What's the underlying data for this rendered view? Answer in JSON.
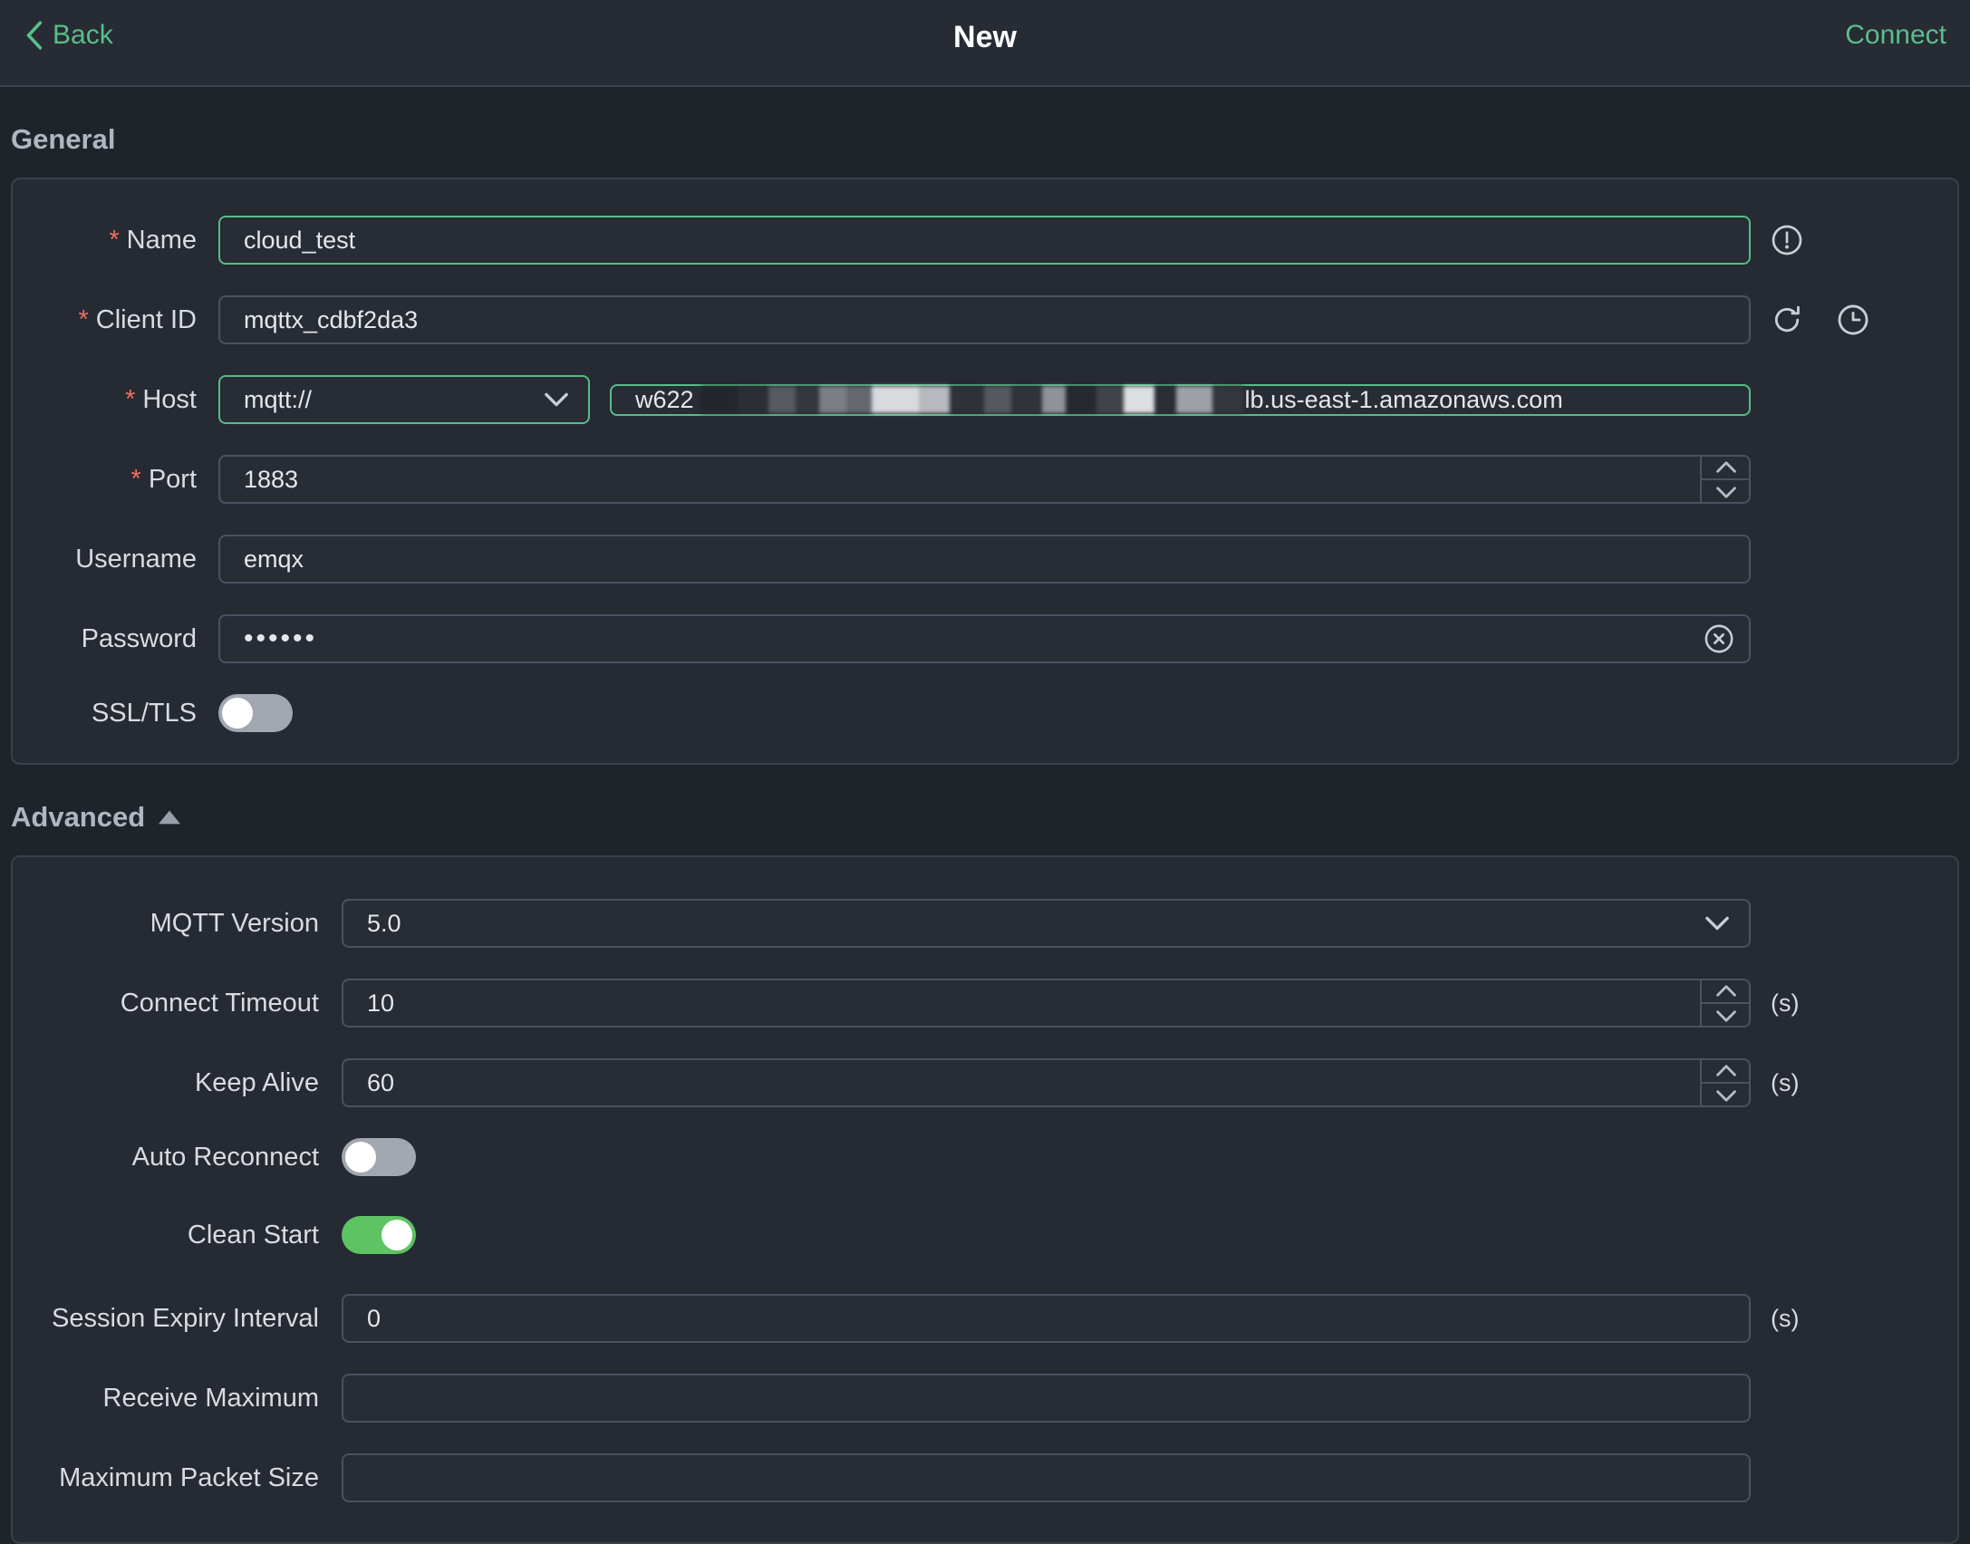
{
  "topbar": {
    "back_label": "Back",
    "title": "New",
    "connect_label": "Connect"
  },
  "ui": {
    "required_marker": "*"
  },
  "sections": {
    "general_title": "General",
    "advanced_title": "Advanced"
  },
  "general": {
    "name": {
      "label": "Name",
      "value": "cloud_test"
    },
    "client_id": {
      "label": "Client ID",
      "value": "mqttx_cdbf2da3"
    },
    "host": {
      "label": "Host",
      "protocol": "mqtt://",
      "value_prefix": "w622",
      "value_suffix": "lb.us-east-1.amazonaws.com"
    },
    "port": {
      "label": "Port",
      "value": "1883"
    },
    "username": {
      "label": "Username",
      "value": "emqx"
    },
    "password": {
      "label": "Password",
      "value": "••••••"
    },
    "ssl": {
      "label": "SSL/TLS",
      "state": "off"
    }
  },
  "advanced": {
    "mqtt_version": {
      "label": "MQTT Version",
      "value": "5.0"
    },
    "connect_timeout": {
      "label": "Connect Timeout",
      "value": "10",
      "unit": "(s)"
    },
    "keep_alive": {
      "label": "Keep Alive",
      "value": "60",
      "unit": "(s)"
    },
    "auto_reconnect": {
      "label": "Auto Reconnect",
      "state": "off"
    },
    "clean_start": {
      "label": "Clean Start",
      "state": "on"
    },
    "session_expiry": {
      "label": "Session Expiry Interval",
      "value": "0",
      "unit": "(s)"
    },
    "receive_maximum": {
      "label": "Receive Maximum",
      "value": ""
    },
    "max_packet_size": {
      "label": "Maximum Packet Size",
      "value": ""
    }
  },
  "colors": {
    "accent_green": "#5abe8a",
    "toggle_on": "#5dc363",
    "required_red": "#ee6d62",
    "background": "#1f232a",
    "panel": "#262a32"
  }
}
